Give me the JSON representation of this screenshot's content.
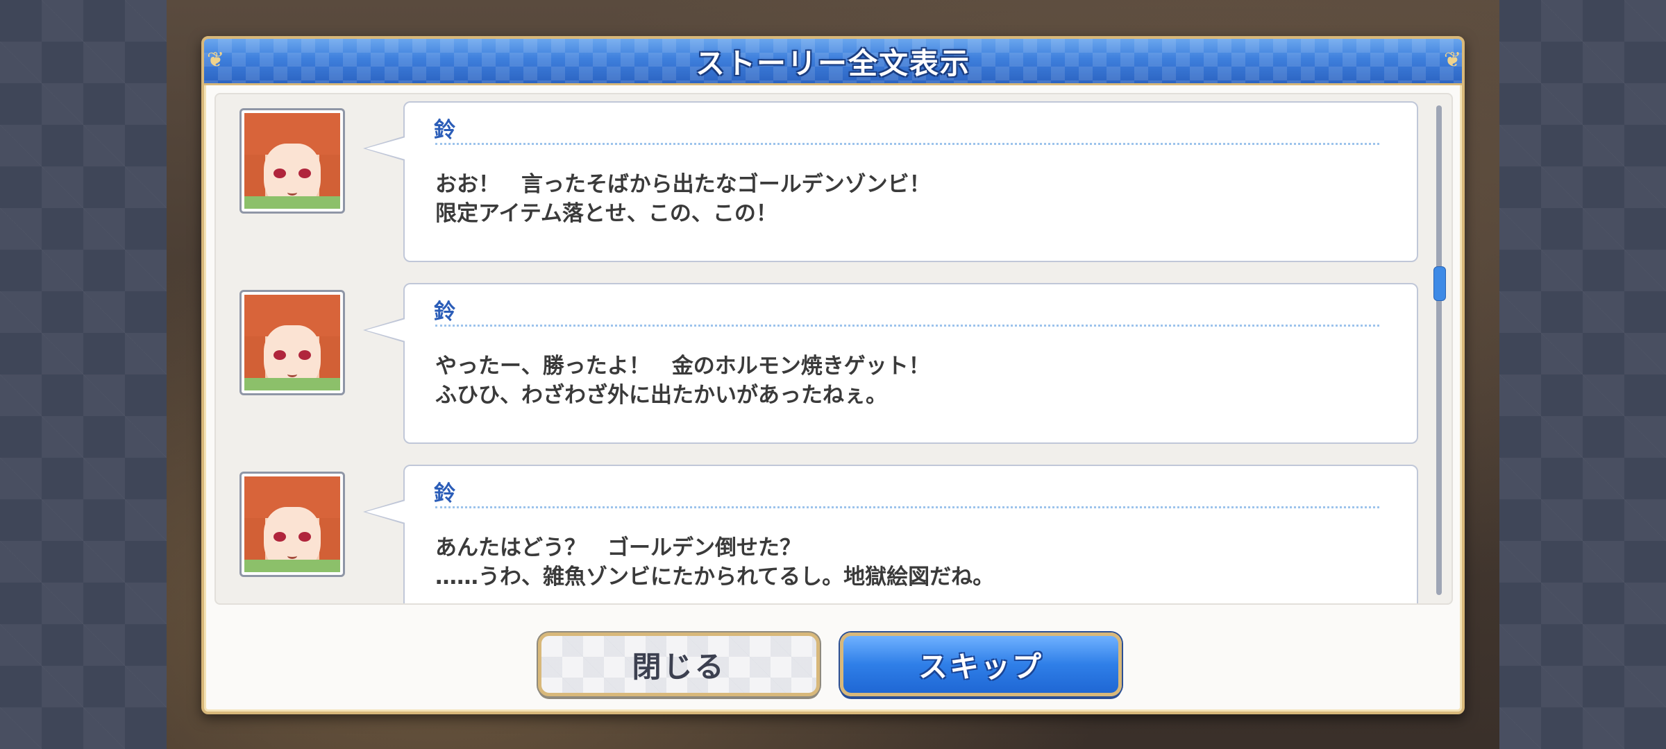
{
  "dialog": {
    "title": "ストーリー全文表示"
  },
  "log": [
    {
      "speaker": "鈴",
      "lines": [
        "おお！　言ったそばから出たなゴールデンゾンビ！",
        "限定アイテム落とせ、この、この！"
      ]
    },
    {
      "speaker": "鈴",
      "lines": [
        "やったー、勝ったよ！　金のホルモン焼きゲット！",
        "ふひひ、わざわざ外に出たかいがあったねぇ。"
      ]
    },
    {
      "speaker": "鈴",
      "lines": [
        "あんたはどう？　ゴールデン倒せた？",
        "……うわ、雑魚ゾンビにたかられてるし。地獄絵図だね。"
      ]
    }
  ],
  "buttons": {
    "close_label": "閉じる",
    "skip_label": "スキップ"
  },
  "colors": {
    "title_bar": "#3e7fdc",
    "frame_gold": "#d8b87a",
    "speaker_name": "#2b5db8",
    "skip_button": "#2f7fe8"
  }
}
